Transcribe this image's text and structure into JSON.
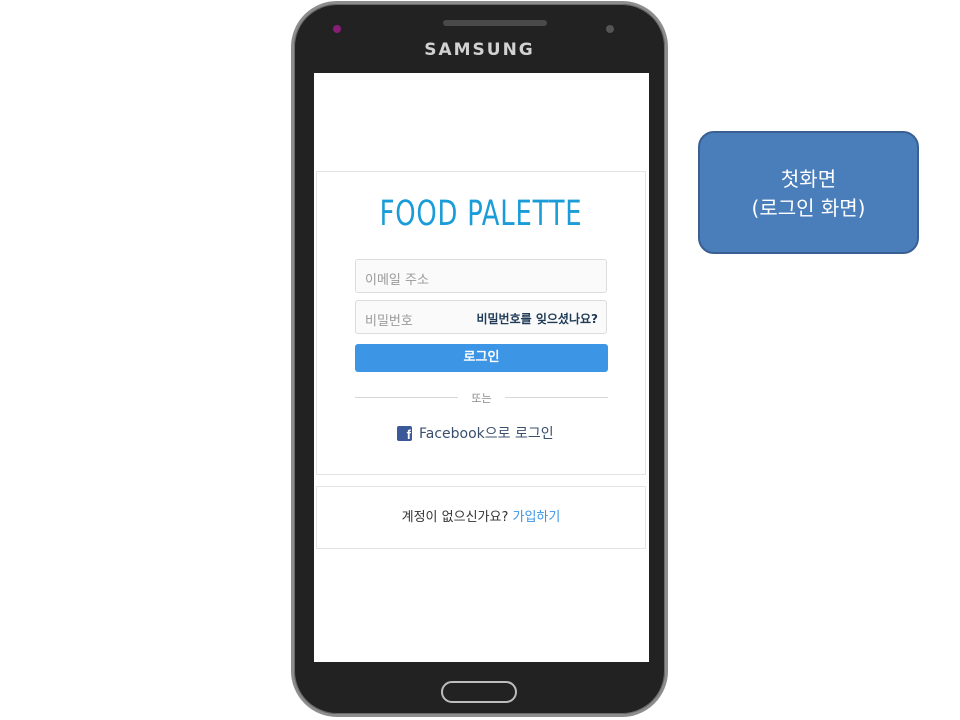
{
  "device": {
    "brand": "SAMSUNG"
  },
  "app": {
    "logo_text": "FOOD PALETTE",
    "login": {
      "email_placeholder": "이메일 주소",
      "password_placeholder": "비밀번호",
      "forgot_password_label": "비밀번호를 잊으셨나요?",
      "login_button_label": "로그인",
      "or_label": "또는",
      "facebook_login_label": "Facebook으로 로그인",
      "facebook_icon_glyph": "f"
    },
    "signup": {
      "prompt_text": "계정이 없으신가요?",
      "signup_link_label": "가입하기"
    }
  },
  "annotation": {
    "line1": "첫화면",
    "line2": "(로그인 화면)"
  },
  "colors": {
    "accent": "#3d95e6",
    "logo": "#1a9cd8",
    "facebook": "#3b5998",
    "note_box": "#4a7ebb"
  }
}
